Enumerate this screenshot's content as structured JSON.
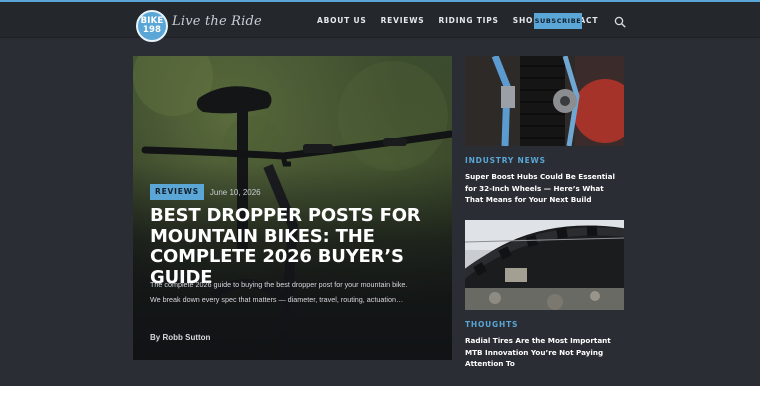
{
  "header": {
    "logo_text_top": "BIKE",
    "logo_text_bottom": "198",
    "tagline": "Live the Ride",
    "nav": [
      {
        "label": "ABOUT US"
      },
      {
        "label": "REVIEWS"
      },
      {
        "label": "RIDING TIPS"
      },
      {
        "label": "SHOP"
      },
      {
        "label": "CONTACT"
      }
    ],
    "subscribe_label": "SUBSCRIBE",
    "search_icon": "search-icon"
  },
  "featured": {
    "category": "REVIEWS",
    "date": "June 10, 2026",
    "title": "BEST DROPPER POSTS FOR MOUNTAIN BIKES: THE COMPLETE 2026 BUYER’S GUIDE",
    "excerpt": "The complete 2026 guide to buying the best dropper post for your mountain bike. We break down every spec that matters — diameter, travel, routing, actuation…",
    "author": "By Robb Sutton"
  },
  "side_articles": [
    {
      "category": "INDUSTRY NEWS",
      "title": "Super Boost Hubs Could Be Essential for 32-Inch Wheels — Here’s What That Means for Your Next Build"
    },
    {
      "category": "THOUGHTS",
      "title": "Radial Tires Are the Most Important MTB Innovation You’re Not Paying Attention To"
    }
  ],
  "colors": {
    "accent": "#5aa6d6",
    "background": "#2a2d33",
    "nav_background": "#24272c"
  }
}
